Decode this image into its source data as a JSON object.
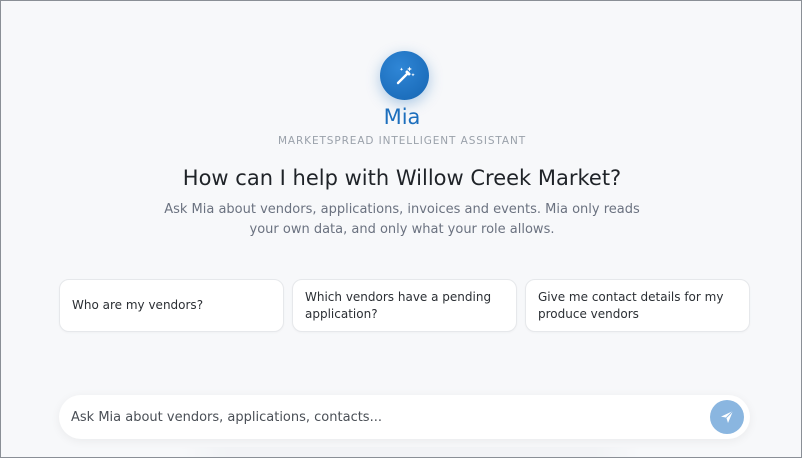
{
  "assistant": {
    "name": "Mia",
    "subtitle": "MARKETSPREAD INTELLIGENT ASSISTANT",
    "avatar_icon": "magic-wand-icon",
    "accent_color": "#1d6fbd"
  },
  "intro": {
    "headline": "How can I help with Willow Creek Market?",
    "description": "Ask Mia about vendors, applications, invoices and events. Mia only reads your own data, and only what your role allows."
  },
  "suggestions": [
    {
      "label": "Who are my vendors?"
    },
    {
      "label": "Which vendors have a pending application?"
    },
    {
      "label": "Give me contact details for my produce vendors"
    }
  ],
  "composer": {
    "placeholder": "Ask Mia about vendors, applications, contacts...",
    "send_icon": "send-icon",
    "send_color": "#8ab6e0"
  }
}
